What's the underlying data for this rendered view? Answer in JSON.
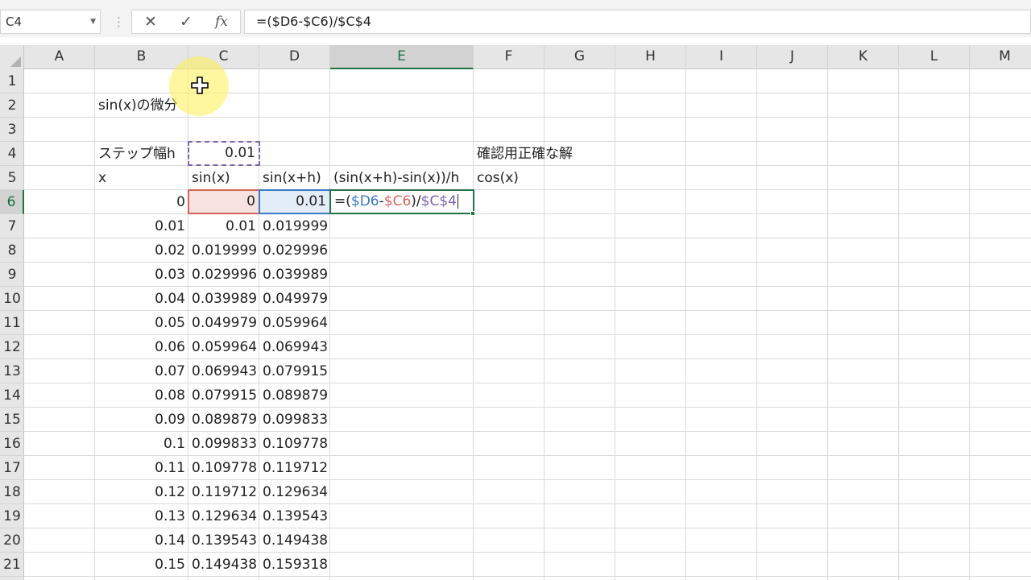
{
  "name_box": {
    "value": "C4"
  },
  "formula_bar": {
    "dots_icon": "vertical-ellipsis-icon",
    "cancel_icon": "cross-icon",
    "enter_icon": "check-icon",
    "fx_label": "fx",
    "formula": "=($D6-$C6)/$C$4"
  },
  "columns": [
    "A",
    "B",
    "C",
    "D",
    "E",
    "F",
    "G",
    "H",
    "I",
    "J",
    "K",
    "L",
    "M"
  ],
  "active_column": "E",
  "rows": [
    "1",
    "2",
    "3",
    "4",
    "5",
    "6",
    "7",
    "8",
    "9",
    "10",
    "11",
    "12",
    "13",
    "14",
    "15",
    "16",
    "17",
    "18",
    "19",
    "20",
    "21"
  ],
  "active_row": "6",
  "sheet": {
    "title_cell": "sin(x)の微分",
    "step_label": "ステップ幅h",
    "step_value": "0.01",
    "check_label": "確認用正確な解",
    "headers": {
      "x": "x",
      "sin": "sin(x)",
      "sin_h": "sin(x+h)",
      "diff": "(sin(x+h)-sin(x))/h",
      "cos": "cos(x)"
    },
    "x_values": [
      "0",
      "0.01",
      "0.02",
      "0.03",
      "0.04",
      "0.05",
      "0.06",
      "0.07",
      "0.08",
      "0.09",
      "0.1",
      "0.11",
      "0.12",
      "0.13",
      "0.14",
      "0.15"
    ],
    "sin_values": [
      "0",
      "0.01",
      "0.019999",
      "0.029996",
      "0.039989",
      "0.049979",
      "0.059964",
      "0.069943",
      "0.079915",
      "0.089879",
      "0.099833",
      "0.109778",
      "0.119712",
      "0.129634",
      "0.139543",
      "0.149438"
    ],
    "sin_h_values": [
      "0.01",
      "0.019999",
      "0.029996",
      "0.039989",
      "0.049979",
      "0.059964",
      "0.069943",
      "0.079915",
      "0.089879",
      "0.099833",
      "0.109778",
      "0.119712",
      "0.129634",
      "0.139543",
      "0.149438",
      "0.159318"
    ],
    "edit_cell": {
      "eq": "=(",
      "ref_d": "$D6",
      "op1": "-",
      "ref_c6": "$C6",
      "op2": ")/",
      "ref_c4": "$C$4"
    }
  },
  "colors": {
    "accent": "#217346",
    "ref_d": "#3c78c3",
    "ref_c6": "#d6625c",
    "ref_c4": "#7b63b4",
    "highlight": "#fff050"
  },
  "cursor_icon": "move-cursor-icon"
}
